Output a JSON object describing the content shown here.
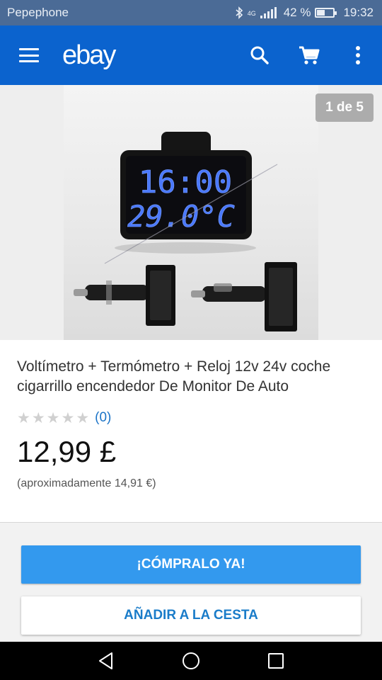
{
  "status_bar": {
    "carrier": "Pepephone",
    "network_label": "4G",
    "battery_text": "42 %",
    "battery_level": 0.42,
    "time": "19:32",
    "icons": [
      "bluetooth-icon",
      "signal-icon",
      "battery-icon"
    ]
  },
  "app_bar": {
    "logo": "ebay",
    "icons": [
      "menu-icon",
      "search-icon",
      "cart-icon",
      "more-vert-icon"
    ],
    "background": "#0b63ce"
  },
  "gallery": {
    "counter": "1 de 5",
    "display_line1": "16:00",
    "display_line2": "29.0°C"
  },
  "product": {
    "title": "Voltímetro + Termómetro + Reloj 12v 24v coche cigarrillo encendedor De Monitor De Auto",
    "rating_stars": 0,
    "review_count": "(0)",
    "price": "12,99 £",
    "approx_price": "(aproximadamente 14,91 €)"
  },
  "actions": {
    "buy_now": "¡CÓMPRALO YA!",
    "add_to_cart": "AÑADIR A LA CESTA",
    "buy_color": "#3399ee",
    "cart_text_color": "#1a7cc9"
  },
  "nav_bar": {
    "icons": [
      "back-icon",
      "home-icon",
      "recents-icon"
    ]
  }
}
